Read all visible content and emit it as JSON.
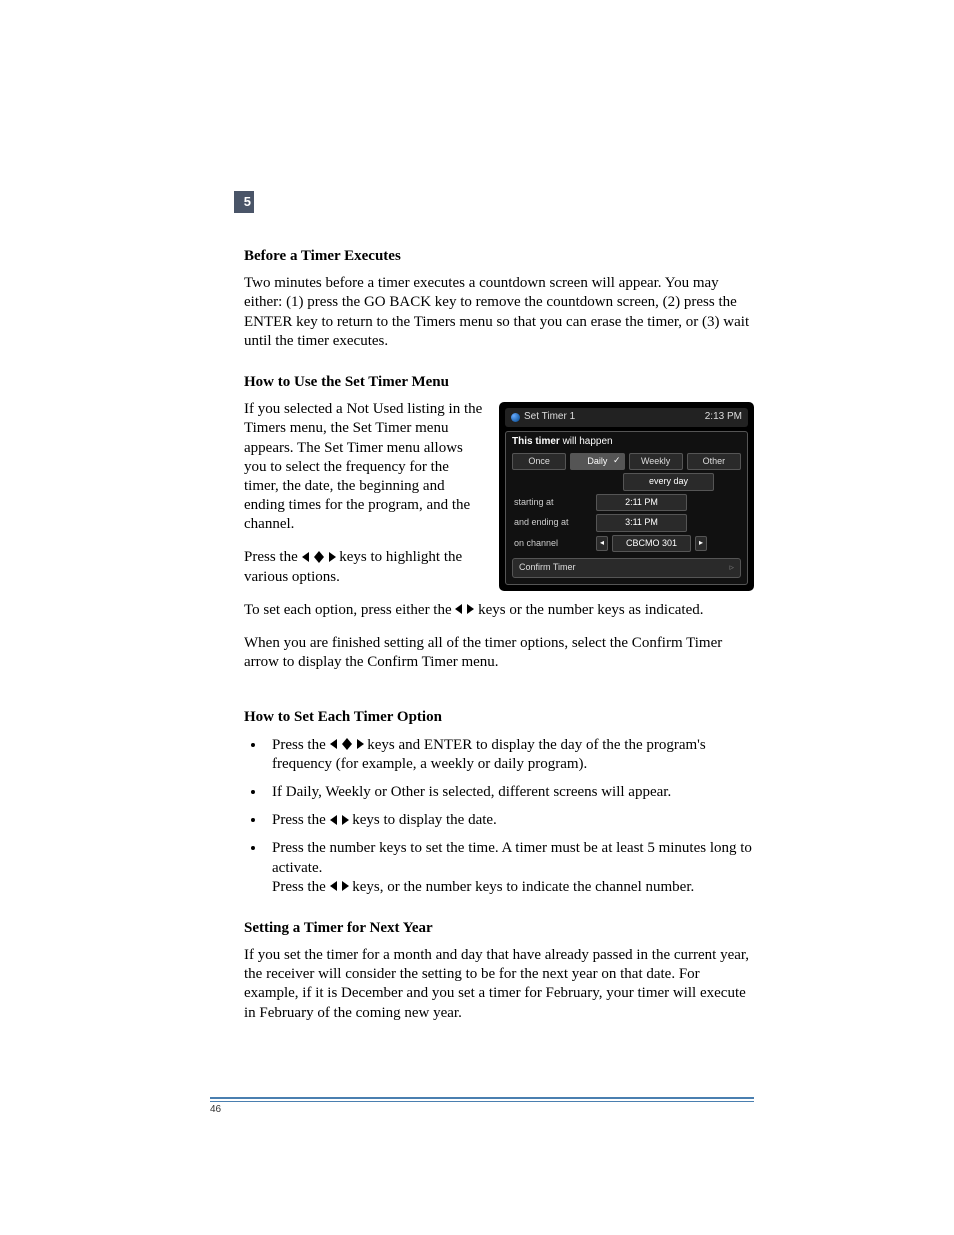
{
  "chapter_tab": "5",
  "page_number": "46",
  "sec1": {
    "heading": "Before a Timer Executes",
    "body": "Two minutes before a timer executes a countdown screen will appear. You may either: (1) press the GO BACK key to remove the countdown screen, (2) press the ENTER key to return to the Timers menu so that you can erase the timer, or (3) wait until the timer executes."
  },
  "sec2": {
    "heading": "How to Use the Set Timer Menu",
    "p1": "If you selected a Not Used listing in the Timers menu, the Set Timer menu appears. The Set Timer menu allows you to select the frequency for the timer, the date, the beginning and ending times for the program, and the channel.",
    "p2a": "Press the ",
    "p2b": " keys to highlight the various options.",
    "p3a": "To set each option, press either the ",
    "p3b": " keys or the number keys as indicated.",
    "p4": "When you are finished setting all of the timer options, select the Confirm Timer arrow to display the Confirm Timer menu."
  },
  "tv": {
    "title": "Set Timer 1",
    "clock": "2:13 PM",
    "caption": "This timer will happen",
    "opt1": "Once",
    "opt2": "Daily",
    "opt3": "Weekly",
    "opt4": "Other",
    "every": "every day",
    "l_start": "starting at",
    "v_start": "2:11 PM",
    "l_end": "and ending at",
    "v_end": "3:11 PM",
    "l_chan": "on channel",
    "v_chan": "CBCMO 301",
    "confirm": "Confirm Timer"
  },
  "sec3": {
    "heading": "How to Set Each Timer Option",
    "b1a": "Press the ",
    "b1b": " keys and ENTER to display the day of the the program's frequency (for example, a weekly or daily program).",
    "b2": "If Daily, Weekly or Other is selected, different screens will appear.",
    "b3a": "Press the ",
    "b3b": " keys to display the date.",
    "b4a": "Press the number keys to set the time. A timer must be at least 5 minutes long to activate.",
    "b4b_a": "Press the ",
    "b4b_b": " keys, or the number keys to indicate the channel number."
  },
  "sec4": {
    "heading": "Setting a Timer for Next Year",
    "body": "If you set the timer for a month and day that have already passed in the current year, the receiver will consider the setting to be for the next year on that date. For example, if it is December and you set a timer for February, your timer will execute in February of the coming new year."
  }
}
